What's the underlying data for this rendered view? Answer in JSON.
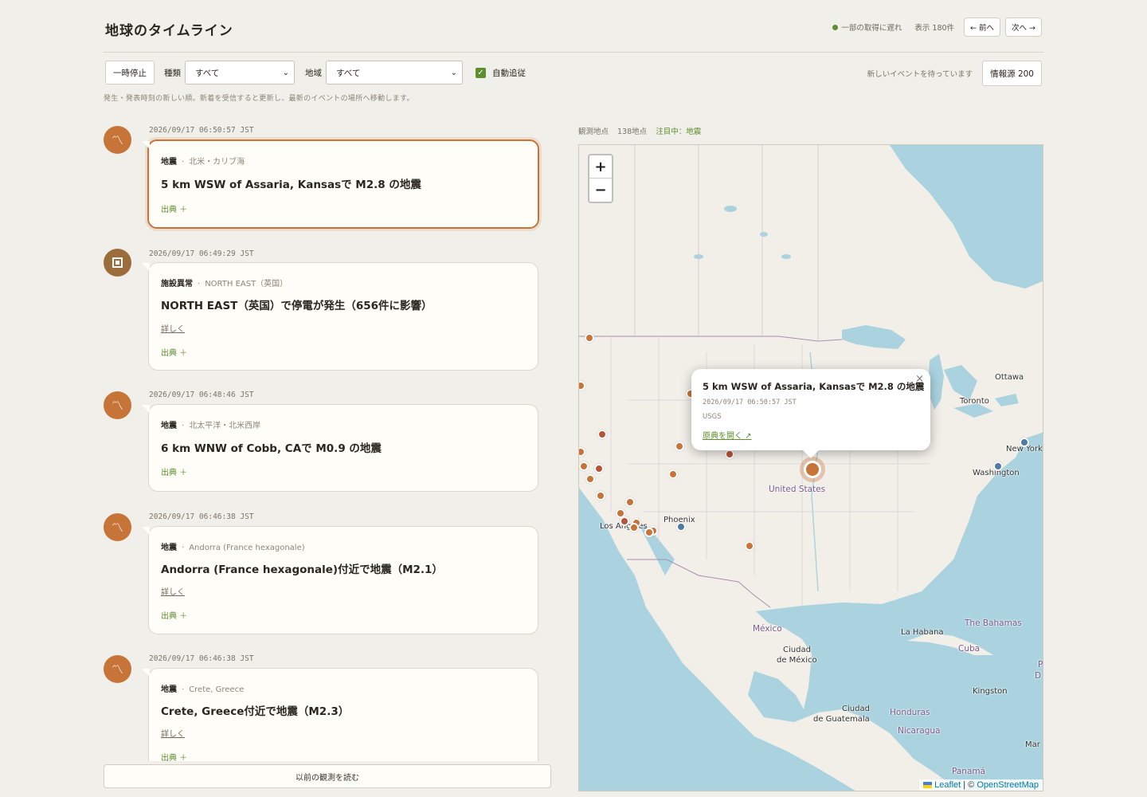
{
  "header": {
    "title": "地球のタイムライン",
    "status_text": "一部の取得に遅れ",
    "count_text": "表示 180件",
    "prev_label": "← 前へ",
    "next_label": "次へ →",
    "status_color": "#5d8f2e"
  },
  "filters": {
    "pause_label": "一時停止",
    "type_label": "種類",
    "type_value": "すべて",
    "region_label": "地域",
    "region_value": "すべて",
    "autofollow_label": "自動追従",
    "autofollow_checked": true,
    "waiting_text": "新しいイベントを待っています",
    "sources_label": "情報源 200",
    "hint": "発生・発表時刻の新しい順。新着を受信すると更新し、最新のイベントの場所へ移動します。"
  },
  "timeline": {
    "entries": [
      {
        "time": "2026/09/17 06:50:57 JST",
        "category": "地震",
        "region": "北米・カリブ海",
        "title": "5 km WSW of Assaria, Kansasで M2.8 の地震",
        "details_label": "",
        "source_label": "出典 ＋",
        "icon": "quake-icon",
        "active": true
      },
      {
        "time": "2026/09/17 06:49:29 JST",
        "category": "施設異常",
        "region": "NORTH EAST（英国）",
        "title": "NORTH EAST（英国）で停電が発生（656件に影響）",
        "details_label": "詳しく",
        "source_label": "出典 ＋",
        "icon": "facility-icon",
        "active": false
      },
      {
        "time": "2026/09/17 06:48:46 JST",
        "category": "地震",
        "region": "北太平洋・北米西岸",
        "title": "6 km WNW of Cobb, CAで M0.9 の地震",
        "details_label": "",
        "source_label": "出典 ＋",
        "icon": "quake-icon",
        "active": false
      },
      {
        "time": "2026/09/17 06:46:38 JST",
        "category": "地震",
        "region": "Andorra (France hexagonale)",
        "title": "Andorra (France hexagonale)付近で地震（M2.1）",
        "details_label": "詳しく",
        "source_label": "出典 ＋",
        "icon": "quake-icon",
        "active": false
      },
      {
        "time": "2026/09/17 06:46:38 JST",
        "category": "地震",
        "region": "Crete, Greece",
        "title": "Crete, Greece付近で地震（M2.3）",
        "details_label": "詳しく",
        "source_label": "出典 ＋",
        "icon": "quake-icon",
        "active": false
      }
    ],
    "load_more_label": "以前の観測を読む"
  },
  "map": {
    "observations_label": "観測地点",
    "observations_count": "138地点",
    "focus_label": "注目中：",
    "focus_value": "地震",
    "zoom_in": "+",
    "zoom_out": "−",
    "popup": {
      "title": "5 km WSW of Assaria, Kansasで M2.8 の地震",
      "time": "2026/09/17 06:50:57 JST",
      "source": "USGS",
      "link_label": "原典を開く ↗",
      "close_label": "×"
    },
    "place_labels": {
      "ottawa": "Ottawa",
      "toronto": "Toronto",
      "new_york": "New York",
      "washington": "Washington",
      "united_states": "United States",
      "phoenix": "Phoenix",
      "los_angeles": "Los Angeles",
      "mexico": "México",
      "mexico_city_1": "Ciudad",
      "mexico_city_2": "de México",
      "la_habana": "La Habana",
      "bahamas": "The Bahamas",
      "cuba": "Cuba",
      "kingston": "Kingston",
      "guatemala_1": "Ciudad",
      "guatemala_2": "de Guatemala",
      "honduras": "Honduras",
      "nicaragua": "Nicaragua",
      "panama": "Panamá",
      "edge_p": "P",
      "edge_d": "D",
      "edge_mar": "Mar"
    },
    "attribution": {
      "leaflet": "Leaflet",
      "sep": " | © ",
      "osm": "OpenStreetMap"
    },
    "colors": {
      "quake": "#c77438",
      "facility": "#9b6d3d",
      "other": "#4f7aa1",
      "water": "#aad3df",
      "land": "#f2efe9"
    }
  }
}
